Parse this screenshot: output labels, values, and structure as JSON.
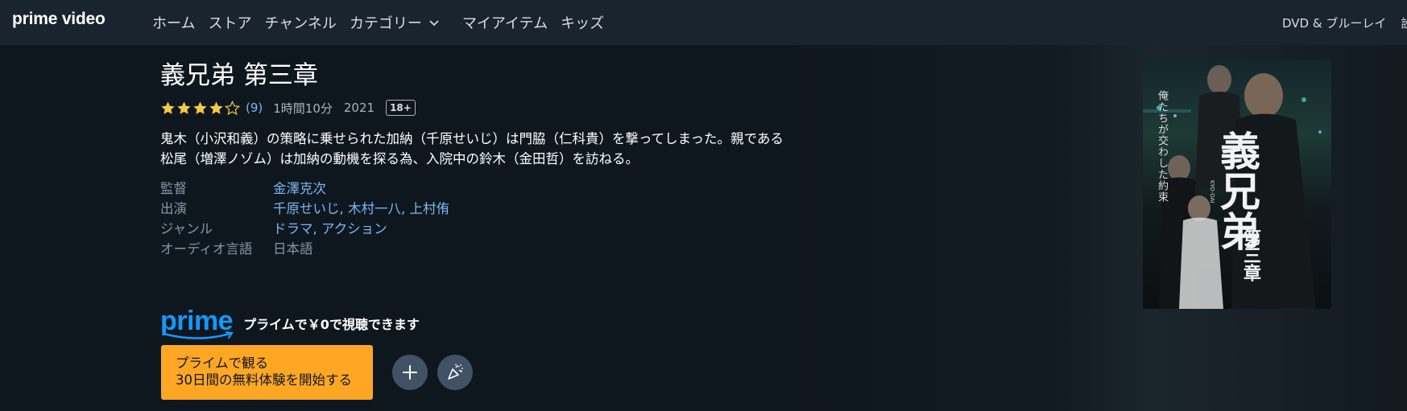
{
  "nav": {
    "logo": "prime video",
    "links": [
      "ホーム",
      "ストア",
      "チャンネル",
      "カテゴリー",
      "マイアイテム",
      "キッズ"
    ],
    "right_link": "DVD & ブルーレイ",
    "right_cut": "設"
  },
  "title": {
    "text": "義兄弟 第三章",
    "rating_stars": 4,
    "rating_max": 5,
    "rating_count": "(9)",
    "runtime": "1時間10分",
    "year": "2021",
    "age_rating": "18+"
  },
  "synopsis": [
    "鬼木（小沢和義）の策略に乗せられた加納（千原せいじ）は門脇（仁科貴）を撃ってしまった。親である",
    "松尾（増澤ノゾム）は加納の動機を探る為、入院中の鈴木（金田哲）を訪ねる。"
  ],
  "info": [
    {
      "label": "監督",
      "value": "金澤克次"
    },
    {
      "label": "出演",
      "value": "千原せいじ, 木村一八, 上村侑"
    },
    {
      "label": "ジャンル",
      "value": "ドラマ, アクション"
    },
    {
      "label": "オーディオ言語",
      "value": "日本語"
    }
  ],
  "prime": {
    "logo": "prime",
    "text": "プライムで￥0で視聴できます"
  },
  "cta": {
    "line1": "プライムで観る",
    "line2": "30日間の無料体験を開始する"
  },
  "poster": {
    "title": "義兄弟",
    "chapter": "第三章",
    "tagline": "俺たちが交わした約束",
    "romaji": "KYO-DAI"
  },
  "colors": {
    "background": "#0f171e",
    "nav": "#1a242f",
    "link": "#79b8f3",
    "prime_blue": "#1399ff",
    "cta": "#ffa724",
    "star": "#f2c94c"
  },
  "icons": [
    "chevron-down-icon",
    "star-icon",
    "plus-icon",
    "party-icon"
  ]
}
